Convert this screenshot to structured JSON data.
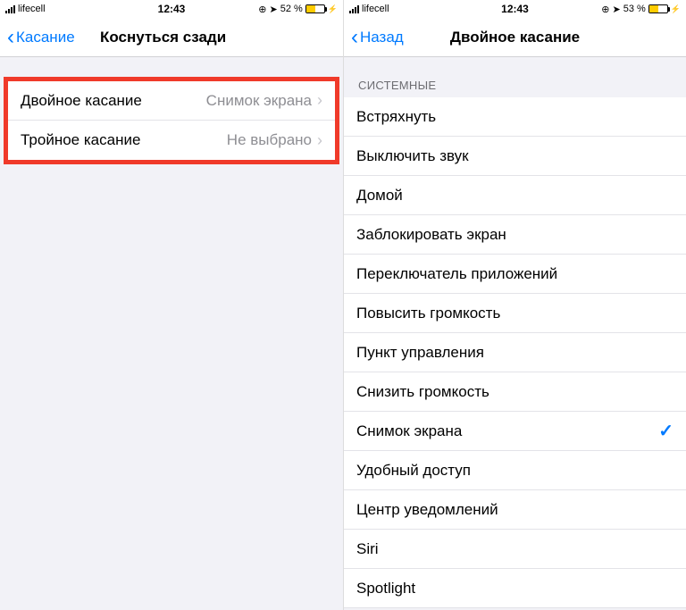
{
  "left": {
    "status": {
      "carrier": "lifecell",
      "time": "12:43",
      "battery_text": "52 %",
      "battery_pct": 52
    },
    "nav": {
      "back_label": "Касание",
      "title": "Коснуться сзади"
    },
    "rows": [
      {
        "label": "Двойное касание",
        "value": "Снимок экрана"
      },
      {
        "label": "Тройное касание",
        "value": "Не выбрано"
      }
    ]
  },
  "right": {
    "status": {
      "carrier": "lifecell",
      "time": "12:43",
      "battery_text": "53 %",
      "battery_pct": 53
    },
    "nav": {
      "back_label": "Назад",
      "title": "Двойное касание"
    },
    "section_header": "СИСТЕМНЫЕ",
    "options": [
      {
        "label": "Встряхнуть",
        "selected": false
      },
      {
        "label": "Выключить звук",
        "selected": false
      },
      {
        "label": "Домой",
        "selected": false
      },
      {
        "label": "Заблокировать экран",
        "selected": false
      },
      {
        "label": "Переключатель приложений",
        "selected": false
      },
      {
        "label": "Повысить громкость",
        "selected": false
      },
      {
        "label": "Пункт управления",
        "selected": false
      },
      {
        "label": "Снизить громкость",
        "selected": false
      },
      {
        "label": "Снимок экрана",
        "selected": true
      },
      {
        "label": "Удобный доступ",
        "selected": false
      },
      {
        "label": "Центр уведомлений",
        "selected": false
      },
      {
        "label": "Siri",
        "selected": false
      },
      {
        "label": "Spotlight",
        "selected": false
      }
    ]
  }
}
